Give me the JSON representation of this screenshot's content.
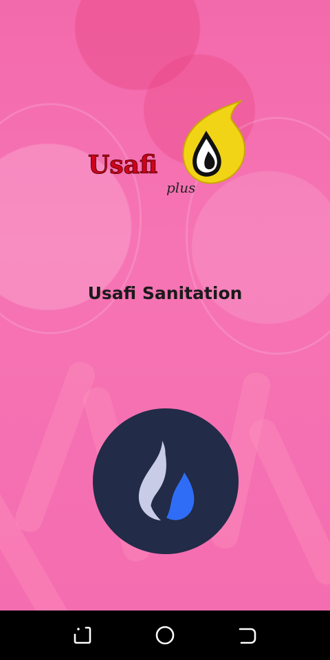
{
  "app": {
    "logo_text": "Usafi",
    "logo_subtext": "plus",
    "title": "Usafi Sanitation"
  },
  "action_button": {
    "icon": "flame-icon"
  },
  "navigation_bar": {
    "back_icon": "back-icon",
    "home_icon": "home-icon",
    "recents_icon": "recents-icon"
  },
  "colors": {
    "background": "#f56fb0",
    "logo_red": "#d0021b",
    "logo_yellow": "#f2d417",
    "title": "#1a1a1a",
    "button_bg": "#222b47",
    "flame_light": "#c9cce6",
    "flame_blue": "#2f6df6",
    "navbar": "#000000"
  }
}
